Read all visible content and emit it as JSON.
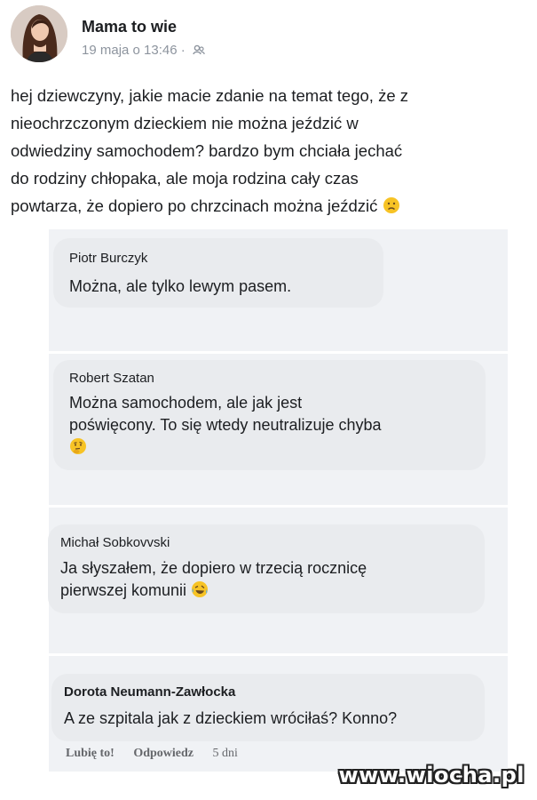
{
  "post": {
    "author": "Mama to wie",
    "timestamp": "19 maja o 13:46",
    "separator": "·",
    "privacy_icon": "friends-globe-icon",
    "text_lines": [
      "hej dziewczyny, jakie macie zdanie na temat tego, że z",
      "nieochrzczonym dzieckiem nie można jeździć w",
      "odwiedziny samochodem? bardzo bym chciała jechać",
      "do rodziny chłopaka, ale moja rodzina cały czas",
      "powtarza, że dopiero po chrzcinach można jeździć"
    ],
    "text_emoji": "worried-face-emoji"
  },
  "comments": [
    {
      "author": "Piotr Burczyk",
      "lines": [
        "Można, ale tylko lewym pasem."
      ]
    },
    {
      "author": "Robert Szatan",
      "lines": [
        "Można samochodem, ale jak jest",
        "poświęcony. To się wtedy neutralizuje chyba"
      ],
      "emoji": "thinking-face-emoji"
    },
    {
      "author": "Michał Sobkovvski",
      "lines": [
        "Ja słyszałem, że dopiero w trzecią rocznicę",
        "pierwszej komunii"
      ],
      "emoji": "rolling-laughing-emoji"
    },
    {
      "author": "Dorota Neumann-Zawłocka",
      "lines": [
        "A ze szpitala jak z dzieckiem wróciłaś? Konno?"
      ]
    }
  ],
  "actions": {
    "like": "Lubię to!",
    "reply": "Odpowiedz",
    "time": "5 dni"
  },
  "watermark": "www.wiocha.pl",
  "colors": {
    "bubble": "#e9ebee",
    "comments_background": "#f0f2f5",
    "meta_text": "#8d949e",
    "emoji_yellow": "#f7c325"
  }
}
